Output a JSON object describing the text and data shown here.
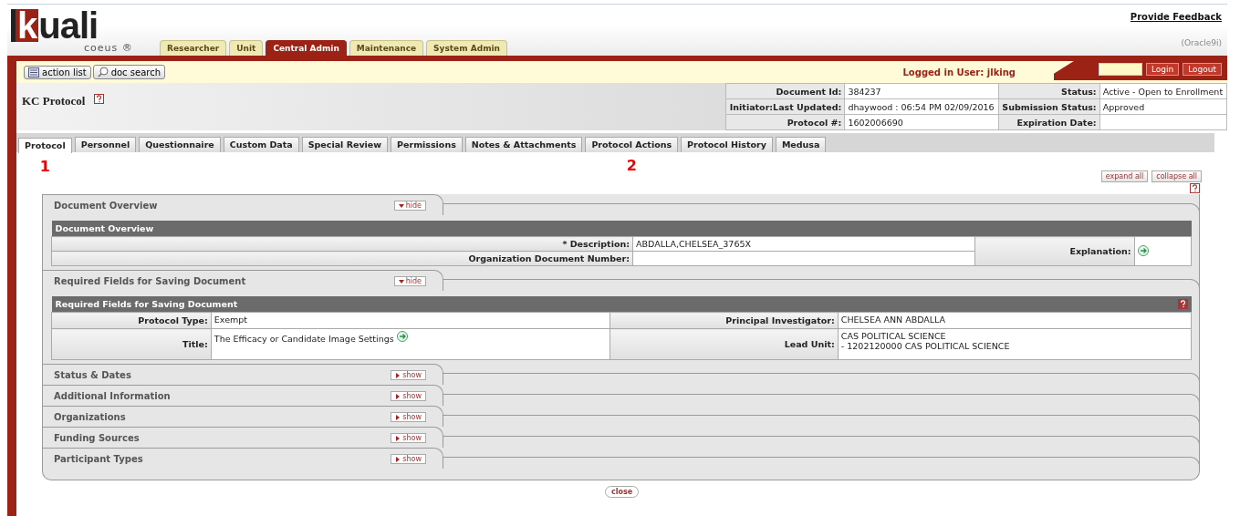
{
  "header": {
    "logo": "kuali",
    "logo_subtitle": "coeus ®",
    "feedback_link": "Provide Feedback",
    "database": "(Oracle9i)"
  },
  "module_tabs": [
    {
      "label": "Researcher",
      "selected": false
    },
    {
      "label": "Unit",
      "selected": false
    },
    {
      "label": "Central Admin",
      "selected": true
    },
    {
      "label": "Maintenance",
      "selected": false
    },
    {
      "label": "System Admin",
      "selected": false
    }
  ],
  "toolbar": {
    "buttons": [
      {
        "label": "action list",
        "kind": "list"
      },
      {
        "label": "doc search",
        "kind": "search"
      }
    ],
    "logged_in": "Logged in User: jlking",
    "login_buttons": [
      "Login",
      "Logout"
    ]
  },
  "document": {
    "title": "KC Protocol",
    "info": [
      {
        "label": "Document Id:",
        "value": "384237",
        "label_2": "Status:",
        "value_2": "Active - Open to Enrollment"
      },
      {
        "label": "Initiator:Last Updated:",
        "value": "dhaywood : 06:54 PM 02/09/2016",
        "label_2": "Submission Status:",
        "value_2": "Approved"
      },
      {
        "label": "Protocol #:",
        "value": "1602006690",
        "label_2": "Expiration Date:"
      }
    ]
  },
  "doc_tabs": [
    {
      "label": "Protocol",
      "selected": true,
      "callout": "1"
    },
    {
      "label": "Personnel",
      "selected": false
    },
    {
      "label": "Questionnaire",
      "selected": false
    },
    {
      "label": "Custom Data",
      "selected": false
    },
    {
      "label": "Special Review",
      "selected": false
    },
    {
      "label": "Permissions",
      "selected": false
    },
    {
      "label": "Notes & Attachments",
      "selected": false
    },
    {
      "label": "Protocol Actions",
      "selected": false,
      "callout": "2"
    },
    {
      "label": "Protocol History",
      "selected": false
    },
    {
      "label": "Medusa",
      "selected": false
    }
  ],
  "page_buttons": [
    "expand all",
    "collapse all"
  ],
  "sections": [
    {
      "title": "Document Overview",
      "expanded": true,
      "toggle_label": "hide",
      "table": {
        "title": "Document Overview",
        "kind": "overview",
        "rows": [
          {
            "label": "* Description:",
            "value": "ABDALLA,CHELSEA_3765X",
            "label_2": "Explanation:",
            "value_2_icon": true
          },
          {
            "label": "Organization Document Number:"
          }
        ]
      }
    },
    {
      "title": "Required Fields for Saving Document",
      "expanded": true,
      "toggle_label": "hide",
      "table": {
        "title": "Required Fields for Saving Document",
        "kind": "required",
        "help": true,
        "rows": [
          {
            "label": "Protocol Type:",
            "value": "Exempt",
            "label_2": "Principal Investigator:",
            "value_2": [
              "CHELSEA ANN ABDALLA"
            ]
          },
          {
            "label": "Title:",
            "value": "The Efficacy or Candidate Image Settings",
            "value_icon": true,
            "label_2": "Lead Unit:",
            "value_2": [
              "CAS POLITICAL SCIENCE",
              "- 1202120000 CAS POLITICAL SCIENCE"
            ]
          }
        ]
      }
    },
    {
      "title": "Status & Dates",
      "expanded": false,
      "toggle_label": "show"
    },
    {
      "title": "Additional Information",
      "expanded": false,
      "toggle_label": "show"
    },
    {
      "title": "Organizations",
      "expanded": false,
      "toggle_label": "show"
    },
    {
      "title": "Funding Sources",
      "expanded": false,
      "toggle_label": "show"
    },
    {
      "title": "Participant Types",
      "expanded": false,
      "toggle_label": "show"
    }
  ],
  "close_button": "close"
}
